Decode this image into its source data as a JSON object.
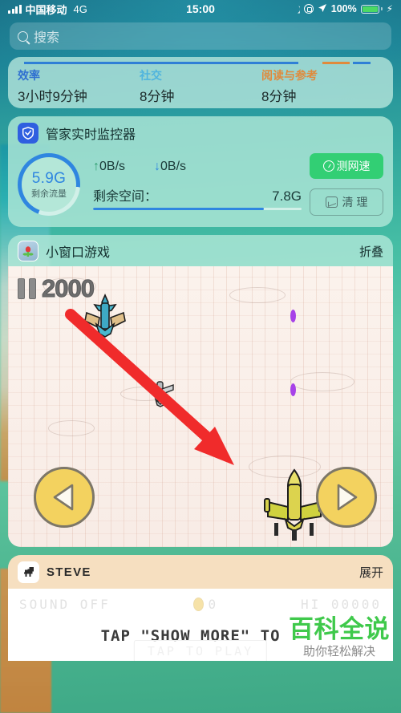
{
  "status_bar": {
    "carrier": "中国移动",
    "network": "4G",
    "time": "15:00",
    "battery_percent": "100%",
    "icons": [
      "signal-bars-icon",
      "moon-icon",
      "rotation-lock-icon",
      "location-arrow-icon",
      "battery-icon",
      "charging-bolt-icon"
    ]
  },
  "search": {
    "placeholder": "搜索",
    "icon": "search-icon"
  },
  "screen_time": {
    "categories": [
      {
        "name": "效率",
        "value": "3小时9分钟",
        "color": "#2f6fd0"
      },
      {
        "name": "社交",
        "value": "8分钟",
        "color": "#4fb4de"
      },
      {
        "name": "阅读与参考",
        "value": "8分钟",
        "color": "#e08a3c"
      }
    ]
  },
  "guard_widget": {
    "title": "管家实时监控器",
    "icon": "shield-check-icon",
    "ring": {
      "value": "5.9G",
      "label": "剩余流量",
      "percent": 71,
      "color": "#2f86e0"
    },
    "upload": {
      "arrow": "↑",
      "value": "0B/s"
    },
    "download": {
      "arrow": "↓",
      "value": "0B/s"
    },
    "storage": {
      "label": "剩余空间：",
      "value": "7.8G",
      "percent": 82
    },
    "speed_button": {
      "label": "测网速",
      "icon": "speedometer-icon",
      "color": "#32cf74"
    },
    "clean_button": {
      "label": "清 理",
      "icon": "image-clean-icon"
    }
  },
  "game_widget": {
    "title": "小窗口游戏",
    "icon": "game-app-icon",
    "action": "折叠",
    "score": "2000",
    "pause_icon": "pause-icon",
    "left_button": "left-arrow-button",
    "right_button": "right-arrow-button"
  },
  "steve_widget": {
    "title": "STEVE",
    "icon": "dinosaur-icon",
    "action": "展开",
    "sound_status": "SOUND OFF",
    "coin_count": "0",
    "high_score": "HI 00000",
    "cta_text": "TAP \"SHOW MORE\" TO P",
    "play_hint": "TAP TO PLAY"
  },
  "watermark": {
    "main": "百科全说",
    "sub": "助你轻松解决",
    "color": "#3fc94b"
  }
}
